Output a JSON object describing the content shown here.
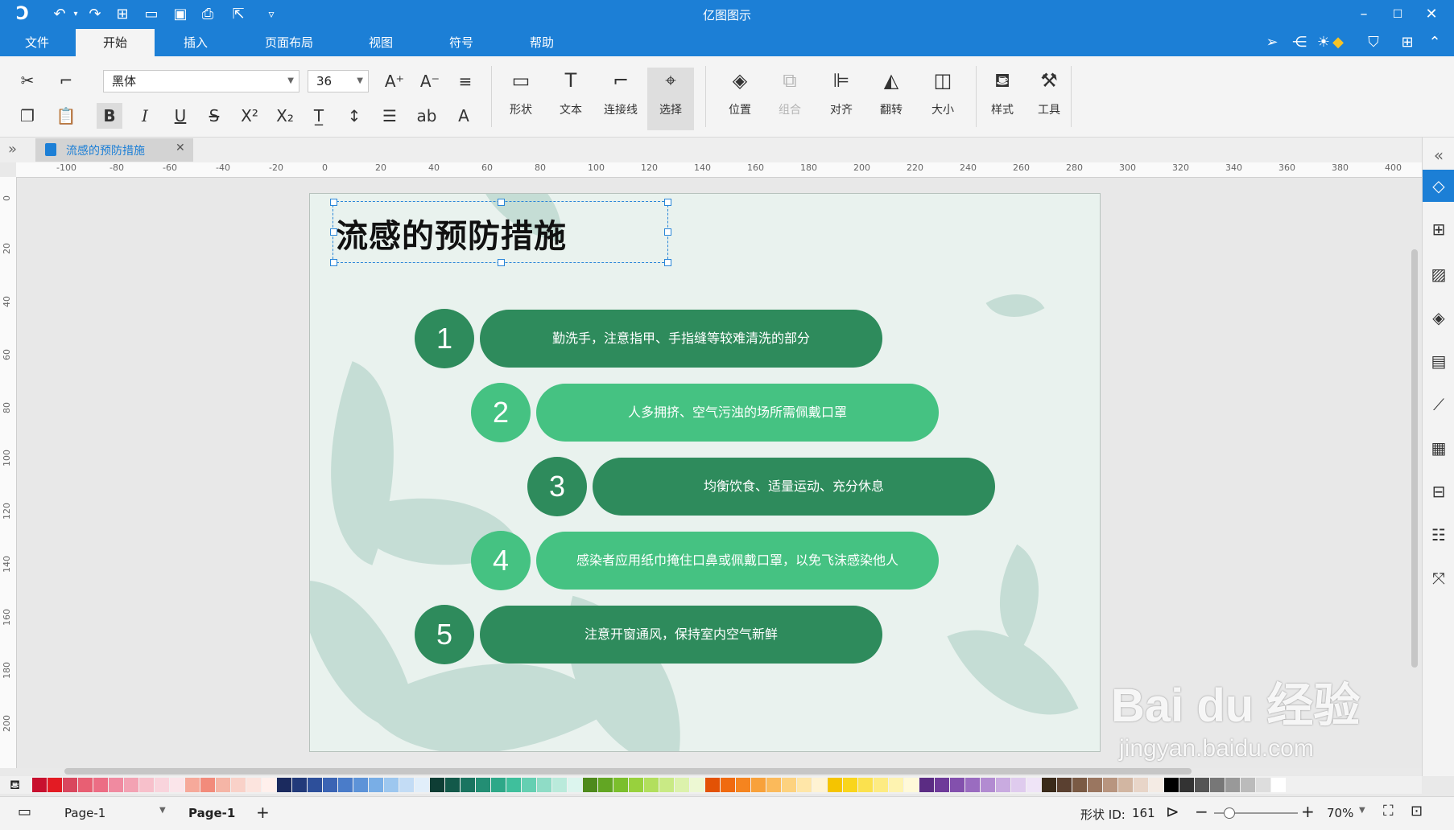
{
  "app": {
    "title": "亿图图示",
    "colors": {
      "accent": "#1c7fd6",
      "dark_green": "#2e8b5c",
      "light_green": "#45c282",
      "page_bg": "#e9f2ee"
    }
  },
  "menu": {
    "tabs": [
      {
        "label": "文件"
      },
      {
        "label": "开始"
      },
      {
        "label": "插入"
      },
      {
        "label": "页面布局"
      },
      {
        "label": "视图"
      },
      {
        "label": "符号"
      },
      {
        "label": "帮助"
      }
    ],
    "active_tab": "开始"
  },
  "ribbon": {
    "font_name": "黑体",
    "font_size": "36",
    "buttons": [
      {
        "label": "形状",
        "icon": "rectangle-icon"
      },
      {
        "label": "文本",
        "icon": "text-icon"
      },
      {
        "label": "连接线",
        "icon": "connector-icon"
      },
      {
        "label": "选择",
        "icon": "cursor-icon"
      },
      {
        "label": "位置",
        "icon": "layers-icon"
      },
      {
        "label": "组合",
        "icon": "group-icon"
      },
      {
        "label": "对齐",
        "icon": "align-icon"
      },
      {
        "label": "翻转",
        "icon": "flip-icon"
      },
      {
        "label": "大小",
        "icon": "size-icon"
      },
      {
        "label": "样式",
        "icon": "paint-bucket-icon"
      },
      {
        "label": "工具",
        "icon": "tools-icon"
      }
    ]
  },
  "document_tab": {
    "label": "流感的预防措施"
  },
  "ruler": {
    "h_labels": [
      "-100",
      "-80",
      "-60",
      "-40",
      "-20",
      "0",
      "20",
      "40",
      "60",
      "80",
      "100",
      "120",
      "140",
      "160",
      "180",
      "200",
      "220",
      "240",
      "260",
      "280",
      "300",
      "320",
      "340",
      "360",
      "380",
      "400"
    ],
    "v_labels": [
      "0",
      "20",
      "40",
      "60",
      "80",
      "100",
      "120",
      "140",
      "160",
      "180",
      "200"
    ]
  },
  "slide": {
    "title": "流感的预防措施",
    "steps": [
      {
        "num": "1",
        "text": "勤洗手，注意指甲、手指缝等较难清洗的部分",
        "shade": "dark"
      },
      {
        "num": "2",
        "text": "人多拥挤、空气污浊的场所需佩戴口罩",
        "shade": "light"
      },
      {
        "num": "3",
        "text": "均衡饮食、适量运动、充分休息",
        "shade": "dark"
      },
      {
        "num": "4",
        "text": "感染者应用纸巾掩住口鼻或佩戴口罩，以免飞沫感染他人",
        "shade": "light"
      },
      {
        "num": "5",
        "text": "注意开窗通风，保持室内空气新鲜",
        "shade": "dark"
      }
    ]
  },
  "status": {
    "page_selector": "Page-1",
    "page_tab": "Page-1",
    "shape_id_label": "形状 ID:",
    "shape_id": "161",
    "zoom": "70%"
  },
  "watermark": {
    "brand": "Bai du 经验",
    "url": "jingyan.baidu.com"
  },
  "palette": [
    "#c8102e",
    "#e31b23",
    "#d9475e",
    "#e85f73",
    "#ec6d84",
    "#f08aa0",
    "#f3a2b3",
    "#f7c0cb",
    "#f9d4dc",
    "#fbe5ea",
    "#f6a99a",
    "#f28b7b",
    "#f5b5a6",
    "#f9d1c8",
    "#fce4de",
    "#fff0ec",
    "#1b2a5e",
    "#223a7a",
    "#2d4f9a",
    "#3b64b4",
    "#4a7cc9",
    "#5d93d8",
    "#79aee6",
    "#9dc7ef",
    "#c3dcf5",
    "#e1eefa",
    "#0e3d34",
    "#13594a",
    "#1a7460",
    "#238e74",
    "#2ea888",
    "#3fbf9c",
    "#65cfb2",
    "#8fdcc6",
    "#baeadb",
    "#dcf5ee",
    "#4e8a1c",
    "#62a623",
    "#7bbf2c",
    "#98d13d",
    "#b2df5d",
    "#c9ea85",
    "#dcf2ac",
    "#edf8d3",
    "#e35205",
    "#f06a0f",
    "#f5841f",
    "#f8a13a",
    "#fbba5b",
    "#fdd27f",
    "#ffe6a8",
    "#fff3d3",
    "#f5c400",
    "#f9d51c",
    "#fbe14e",
    "#fdeb82",
    "#fef3b0",
    "#fff9d9",
    "#5b2c83",
    "#6e3a99",
    "#8350ad",
    "#9a6cc0",
    "#b28bd1",
    "#c9abe0",
    "#dfcbee",
    "#efe4f7",
    "#3a2a1a",
    "#5a4030",
    "#7a5a44",
    "#9a7660",
    "#b8957f",
    "#d2b6a2",
    "#e8d5c8",
    "#f4ebe4",
    "#000000",
    "#333333",
    "#555555",
    "#777777",
    "#999999",
    "#bbbbbb",
    "#dddddd",
    "#ffffff"
  ]
}
